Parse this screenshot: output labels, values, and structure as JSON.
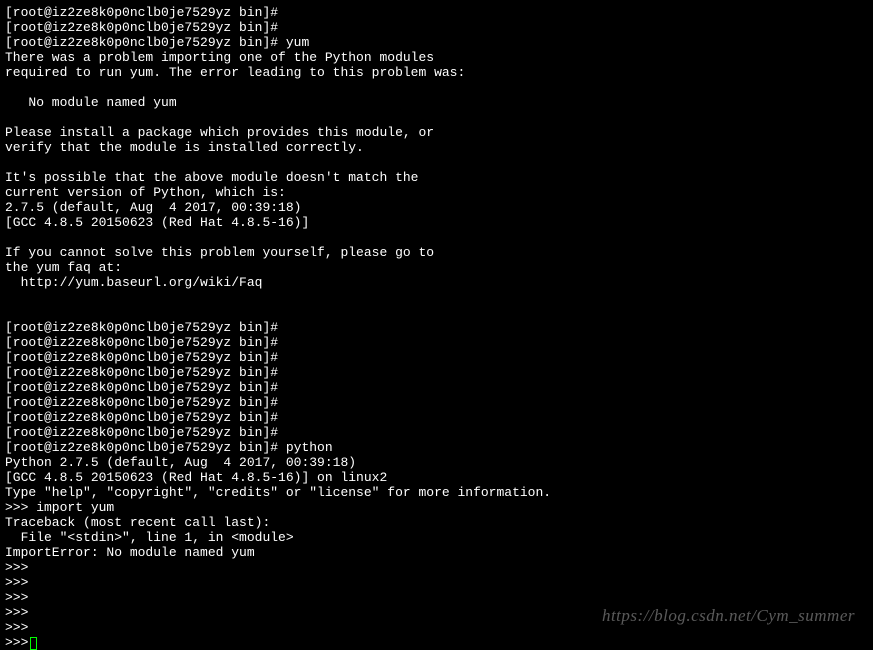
{
  "terminal": {
    "prompt": "[root@iz2ze8k0p0nclb0je7529yz bin]#",
    "lines": [
      {
        "type": "prompt",
        "cmd": ""
      },
      {
        "type": "prompt",
        "cmd": ""
      },
      {
        "type": "prompt",
        "cmd": " yum"
      },
      {
        "type": "output",
        "text": "There was a problem importing one of the Python modules"
      },
      {
        "type": "output",
        "text": "required to run yum. The error leading to this problem was:"
      },
      {
        "type": "output",
        "text": ""
      },
      {
        "type": "output",
        "text": "   No module named yum"
      },
      {
        "type": "output",
        "text": ""
      },
      {
        "type": "output",
        "text": "Please install a package which provides this module, or"
      },
      {
        "type": "output",
        "text": "verify that the module is installed correctly."
      },
      {
        "type": "output",
        "text": ""
      },
      {
        "type": "output",
        "text": "It's possible that the above module doesn't match the"
      },
      {
        "type": "output",
        "text": "current version of Python, which is:"
      },
      {
        "type": "output",
        "text": "2.7.5 (default, Aug  4 2017, 00:39:18)"
      },
      {
        "type": "output",
        "text": "[GCC 4.8.5 20150623 (Red Hat 4.8.5-16)]"
      },
      {
        "type": "output",
        "text": ""
      },
      {
        "type": "output",
        "text": "If you cannot solve this problem yourself, please go to"
      },
      {
        "type": "output",
        "text": "the yum faq at:"
      },
      {
        "type": "output",
        "text": "  http://yum.baseurl.org/wiki/Faq"
      },
      {
        "type": "output",
        "text": ""
      },
      {
        "type": "output",
        "text": ""
      },
      {
        "type": "prompt",
        "cmd": ""
      },
      {
        "type": "prompt",
        "cmd": ""
      },
      {
        "type": "prompt",
        "cmd": ""
      },
      {
        "type": "prompt",
        "cmd": ""
      },
      {
        "type": "prompt",
        "cmd": ""
      },
      {
        "type": "prompt",
        "cmd": ""
      },
      {
        "type": "prompt",
        "cmd": ""
      },
      {
        "type": "prompt",
        "cmd": ""
      },
      {
        "type": "prompt",
        "cmd": " python"
      },
      {
        "type": "output",
        "text": "Python 2.7.5 (default, Aug  4 2017, 00:39:18)"
      },
      {
        "type": "output",
        "text": "[GCC 4.8.5 20150623 (Red Hat 4.8.5-16)] on linux2"
      },
      {
        "type": "output",
        "text": "Type \"help\", \"copyright\", \"credits\" or \"license\" for more information."
      },
      {
        "type": "pyprompt",
        "cmd": " import yum"
      },
      {
        "type": "output",
        "text": "Traceback (most recent call last):"
      },
      {
        "type": "output",
        "text": "  File \"<stdin>\", line 1, in <module>"
      },
      {
        "type": "output",
        "text": "ImportError: No module named yum"
      },
      {
        "type": "pyprompt",
        "cmd": ""
      },
      {
        "type": "pyprompt",
        "cmd": ""
      },
      {
        "type": "pyprompt",
        "cmd": ""
      },
      {
        "type": "pyprompt",
        "cmd": ""
      },
      {
        "type": "pyprompt",
        "cmd": ""
      },
      {
        "type": "pyprompt",
        "cmd": "",
        "cursor": true
      }
    ],
    "pyprompt": ">>>"
  },
  "watermark": "https://blog.csdn.net/Cym_summer"
}
